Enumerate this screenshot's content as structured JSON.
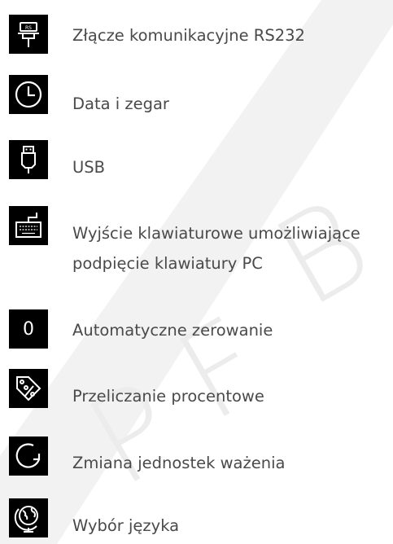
{
  "watermark_colors": {
    "stripe": "#eeeeee",
    "letters": "#ececec"
  },
  "features": [
    {
      "icon": "rs232-connector-icon",
      "label": "Złącze komunikacyjne RS232"
    },
    {
      "icon": "clock-icon",
      "label": "Data i zegar"
    },
    {
      "icon": "usb-icon",
      "label": "USB"
    },
    {
      "icon": "keyboard-icon",
      "line1": "Wyjście klawiaturowe umożliwiające",
      "line2": "podpięcie klawiatury PC"
    },
    {
      "icon": "zero-icon",
      "glyph": "0",
      "label": "Automatyczne zerowanie"
    },
    {
      "icon": "percent-tag-icon",
      "label": "Przeliczanie procentowe"
    },
    {
      "icon": "rotate-arrow-icon",
      "label": "Zmiana jednostek ważenia"
    },
    {
      "icon": "globe-icon",
      "label": "Wybór języka"
    }
  ]
}
